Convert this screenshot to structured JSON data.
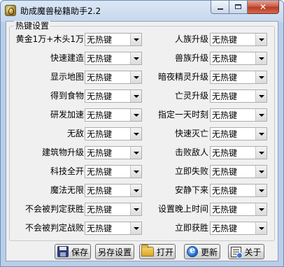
{
  "window": {
    "title": "助成魔兽秘籍助手2.2",
    "close_glyph": "✕"
  },
  "group": {
    "title": "热键设置"
  },
  "left_rows": [
    {
      "label": "黄金1万+木头1万",
      "value": "无热键"
    },
    {
      "label": "快速建造",
      "value": "无热键"
    },
    {
      "label": "显示地图",
      "value": "无热键"
    },
    {
      "label": "得到食物",
      "value": "无热键"
    },
    {
      "label": "研发加速",
      "value": "无热键"
    },
    {
      "label": "无敌",
      "value": "无热键"
    },
    {
      "label": "建筑物升级",
      "value": "无热键"
    },
    {
      "label": "科技全开",
      "value": "无热键"
    },
    {
      "label": "魔法无限",
      "value": "无热键"
    },
    {
      "label": "不会被判定获胜",
      "value": "无热键"
    },
    {
      "label": "不会被判定战败",
      "value": "无热键"
    }
  ],
  "right_rows": [
    {
      "label": "人族升级",
      "value": "无热键"
    },
    {
      "label": "兽族升级",
      "value": "无热键"
    },
    {
      "label": "暗夜精灵升级",
      "value": "无热键"
    },
    {
      "label": "亡灵升级",
      "value": "无热键"
    },
    {
      "label": "指定一天时刻",
      "value": "无热键"
    },
    {
      "label": "快速灭亡",
      "value": "无热键"
    },
    {
      "label": "击败敌人",
      "value": "无热键"
    },
    {
      "label": "立即失败",
      "value": "无热键"
    },
    {
      "label": "安静下来",
      "value": "无热键"
    },
    {
      "label": "设置晚上时间",
      "value": "无热键"
    },
    {
      "label": "立即获胜",
      "value": "无热键"
    }
  ],
  "buttons": {
    "save": "保存",
    "save_as": "另存设置",
    "open": "打开",
    "update": "更新",
    "about": "关于"
  }
}
